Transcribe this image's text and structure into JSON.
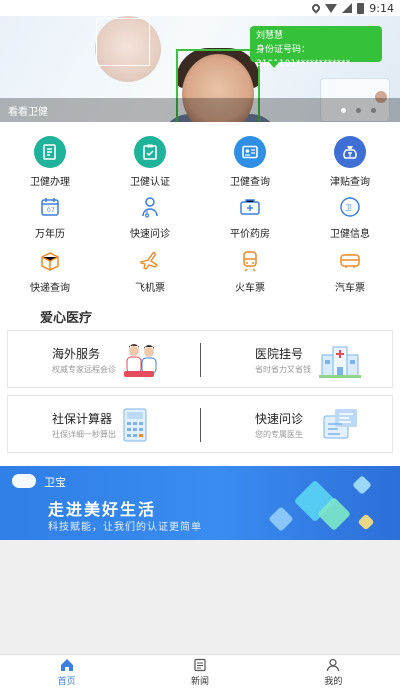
{
  "status_bar": {
    "time": "9:14"
  },
  "banner": {
    "caption": "看看卫健",
    "bubble_name": "刘慧慧",
    "bubble_id": "身份证号码：3101101************",
    "slides": 3,
    "active_slide": 0
  },
  "features_row1": [
    {
      "label": "卫健办理",
      "icon": "document-edit-icon",
      "color": "#1fb39b"
    },
    {
      "label": "卫健认证",
      "icon": "clipboard-check-icon",
      "color": "#1fb39b"
    },
    {
      "label": "卫健查询",
      "icon": "id-card-icon",
      "color": "#2f8fe5"
    },
    {
      "label": "津贴查询",
      "icon": "money-bag-icon",
      "color": "#3f6fd4"
    }
  ],
  "features_row2": [
    {
      "label": "万年历",
      "icon": "calendar-icon"
    },
    {
      "label": "快速问诊",
      "icon": "doctor-icon"
    },
    {
      "label": "平价药房",
      "icon": "medicine-box-icon"
    },
    {
      "label": "卫健信息",
      "icon": "info-badge-icon"
    }
  ],
  "features_row3": [
    {
      "label": "快递查询",
      "icon": "package-icon"
    },
    {
      "label": "飞机票",
      "icon": "airplane-icon"
    },
    {
      "label": "火车票",
      "icon": "train-icon"
    },
    {
      "label": "汽车票",
      "icon": "bus-icon"
    }
  ],
  "section": {
    "title": "爱心医疗"
  },
  "cards": [
    {
      "title": "海外服务",
      "sub": "权威专家远程会诊"
    },
    {
      "title": "医院挂号",
      "sub": "省时省力又省钱"
    },
    {
      "title": "社保计算器",
      "sub": "社保详细一秒算出"
    },
    {
      "title": "快速问诊",
      "sub": "您的专属医生"
    }
  ],
  "promo": {
    "logo_text": "卫宝",
    "headline": "走进美好生活",
    "sub": "科技赋能，让我们的认证更简单"
  },
  "tabbar": [
    {
      "label": "首页",
      "icon": "home-icon",
      "active": true
    },
    {
      "label": "新闻",
      "icon": "news-icon",
      "active": false
    },
    {
      "label": "我的",
      "icon": "user-icon",
      "active": false
    }
  ],
  "colors": {
    "accent": "#3c7fe0",
    "green_frame": "#3ec23e"
  }
}
